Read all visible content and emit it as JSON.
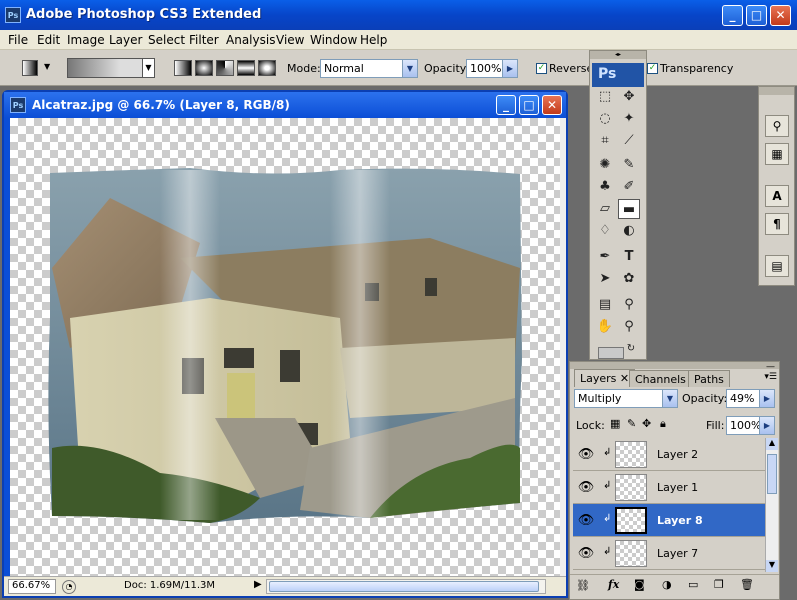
{
  "app": {
    "title": "Adobe Photoshop CS3 Extended",
    "icon": "ps-icon"
  },
  "menu": [
    "File",
    "Edit",
    "Image",
    "Layer",
    "Select",
    "Filter",
    "Analysis",
    "View",
    "Window",
    "Help"
  ],
  "options_bar": {
    "mode_label": "Mode:",
    "mode_value": "Normal",
    "opacity_label": "Opacity:",
    "opacity_value": "100%",
    "reverse_label": "Reverse",
    "reverse_checked": true,
    "transparency_label": "Transparency",
    "transparency_checked": true
  },
  "document": {
    "title": "Alcatraz.jpg @ 66.7% (Layer 8, RGB/8)",
    "zoom": "66.67%",
    "doc_info": "Doc: 1.69M/11.3M"
  },
  "tools_panel": {
    "logo": "Ps",
    "tools": [
      "rect-marquee-icon",
      "move-icon",
      "lasso-icon",
      "magic-wand-icon",
      "crop-icon",
      "eyedropper-slice-icon",
      "healing-icon",
      "brush-icon",
      "stamp-icon",
      "history-brush-icon",
      "eraser-icon",
      "gradient-icon",
      "blur-icon",
      "dodge-icon",
      "pen-icon",
      "type-icon",
      "path-select-icon",
      "shape-icon",
      "notes-icon",
      "eyedropper-icon",
      "hand-icon",
      "zoom-icon"
    ]
  },
  "layers_panel": {
    "tabs": [
      "Layers",
      "Channels",
      "Paths"
    ],
    "blend_mode": "Multiply",
    "opacity_label": "Opacity:",
    "opacity_value": "49%",
    "lock_label": "Lock:",
    "fill_label": "Fill:",
    "fill_value": "100%",
    "layers": [
      {
        "name": "Layer 2",
        "selected": false
      },
      {
        "name": "Layer 1",
        "selected": false
      },
      {
        "name": "Layer 8",
        "selected": true
      },
      {
        "name": "Layer 7",
        "selected": false
      }
    ]
  },
  "colors": {
    "xp_blue": "#0b4ed6",
    "panel_gray": "#d4d0c8",
    "selection": "#3168c6"
  }
}
